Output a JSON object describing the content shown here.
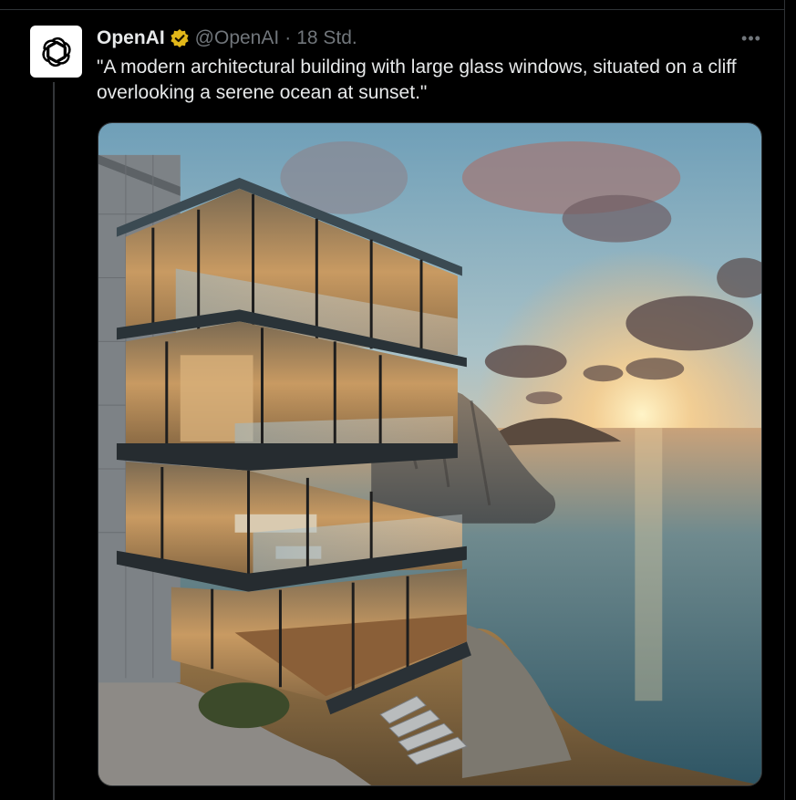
{
  "tweet": {
    "author_name": "OpenAI",
    "handle": "@OpenAI",
    "separator": "·",
    "time": "18 Std.",
    "text": "\"A modern architectural building with large glass windows, situated on a cliff overlooking a serene ocean at sunset.\"",
    "more_label": "•••",
    "avatar_icon": "openai-logo-icon",
    "badge_icon": "verified-gold-badge-icon",
    "badge_color": "#e2b719"
  },
  "media": {
    "image_icon": "generated-image"
  },
  "theme": {
    "background": "#000000",
    "text_primary": "#e7e9ea",
    "text_secondary": "#71767b",
    "border": "#2f3336"
  }
}
